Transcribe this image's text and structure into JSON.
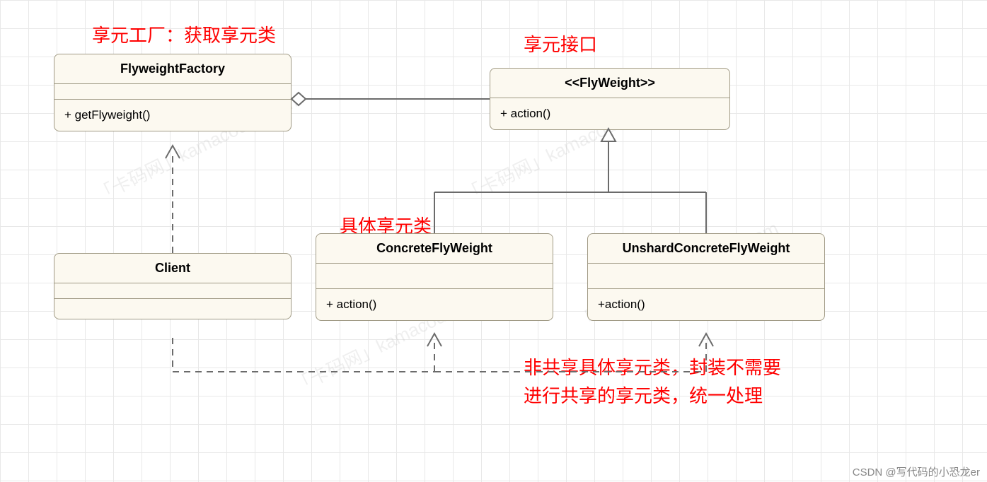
{
  "labels": {
    "factory_note": "享元工厂：获取享元类",
    "interface_note": "享元接口",
    "concrete_note": "具体享元类",
    "unshared_note1": "非共享具体享元类，封装不需要",
    "unshared_note2": "进行共享的享元类，统一处理"
  },
  "classes": {
    "factory": {
      "name": "FlyweightFactory",
      "method": "+ getFlyweight()"
    },
    "flyweight": {
      "name": "<<FlyWeight>>",
      "method": "+ action()"
    },
    "client": {
      "name": "Client",
      "method": ""
    },
    "concrete": {
      "name": "ConcreteFlyWeight",
      "method": "+ action()"
    },
    "unshared": {
      "name": "UnshardConcreteFlyWeight",
      "method": "+action()"
    }
  },
  "watermarks": {
    "w1": "「卡码网」kamacoder.com",
    "w2": "「卡码网」kamacoder.com",
    "w3": "「卡码网」kamacoder.com",
    "w4": "「卡码网」kamacoder.com"
  },
  "attribution": "CSDN @写代码的小恐龙er"
}
